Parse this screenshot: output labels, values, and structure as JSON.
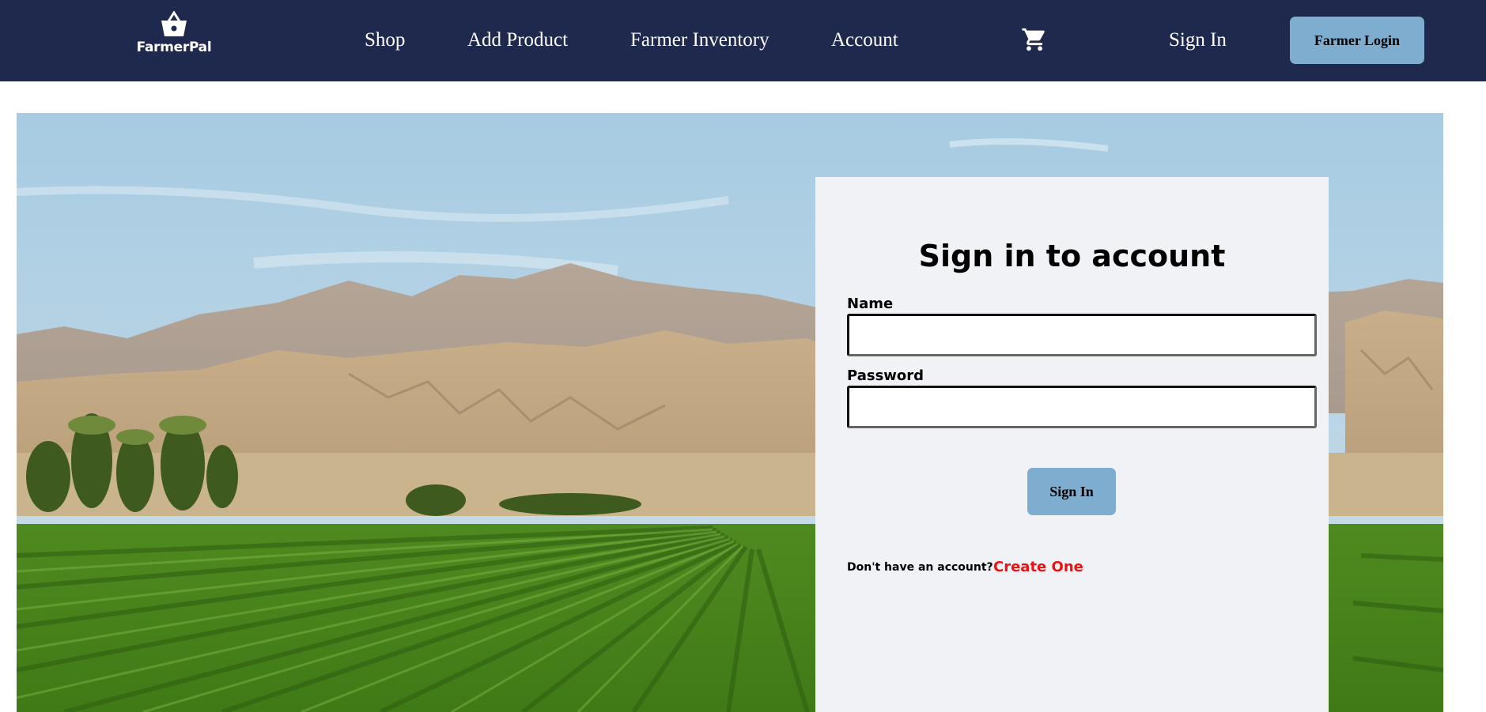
{
  "brand": {
    "name": "FarmerPal",
    "icon": "basket-icon"
  },
  "nav": {
    "links": [
      "Shop",
      "Add Product",
      "Farmer Inventory",
      "Account"
    ],
    "cart_icon": "shopping-cart-icon",
    "sign_in": "Sign In",
    "farmer_login": "Farmer Login"
  },
  "form": {
    "title": "Sign in to account",
    "name_label": "Name",
    "name_value": "",
    "password_label": "Password",
    "password_value": "",
    "submit_label": "Sign In",
    "no_account_text": "Don't have an account?",
    "create_link": "Create One"
  },
  "colors": {
    "navbar": "#1f294d",
    "button": "#7eadcf",
    "card": "#f0f2f5",
    "link": "#ee1111"
  }
}
